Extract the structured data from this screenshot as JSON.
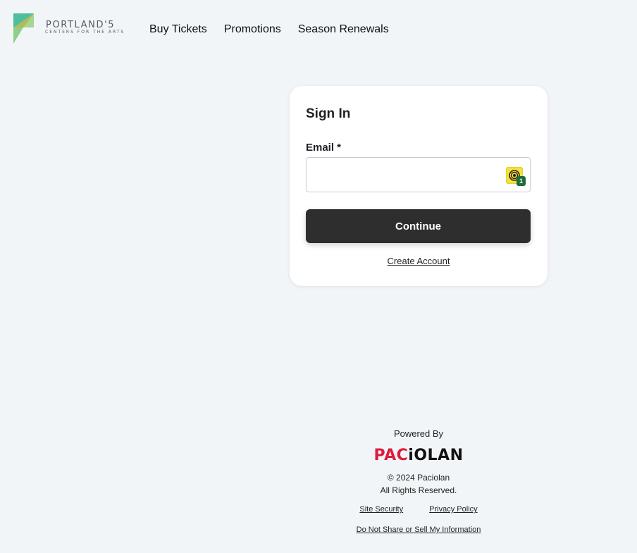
{
  "header": {
    "logo": {
      "main_text": "PORTLAND'5",
      "sub_text": "CENTERS FOR THE ARTS",
      "colors": [
        "#4cbf9f",
        "#8fcf8a",
        "#c9b84a"
      ]
    },
    "nav": [
      {
        "label": "Buy Tickets"
      },
      {
        "label": "Promotions"
      },
      {
        "label": "Season Renewals"
      }
    ]
  },
  "signin": {
    "title": "Sign In",
    "email_label": "Email *",
    "email_value": "",
    "email_placeholder": "",
    "password_manager_badge": "1",
    "continue_label": "Continue",
    "create_account_label": "Create Account"
  },
  "footer": {
    "powered_by": "Powered By",
    "brand_red": "PAC",
    "brand_black": "iOLAN",
    "brand_color": "#e01a3c",
    "copyright": "© 2024 Paciolan",
    "rights": "All Rights Reserved.",
    "links": [
      {
        "label": "Site Security"
      },
      {
        "label": "Privacy Policy"
      }
    ],
    "do_not_sell": "Do Not Share or Sell My Information"
  }
}
